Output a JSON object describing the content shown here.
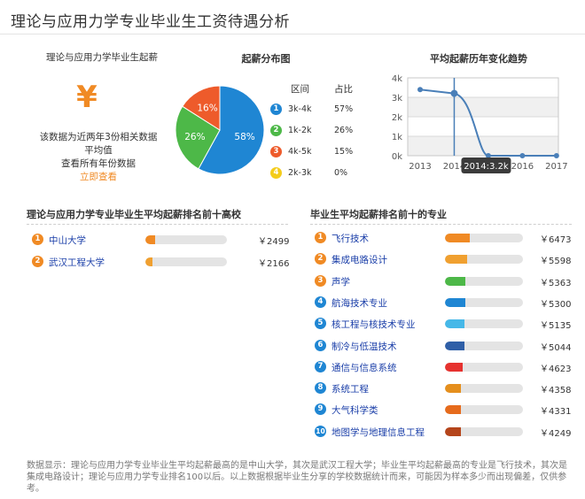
{
  "page": {
    "title": "理论与应用力学专业毕业生工资待遇分析"
  },
  "salary": {
    "title": "理论与应用力学毕业生起薪",
    "icon": "yen-icon",
    "desc_lines": [
      "该数据为近两年3份相关数据",
      "平均值",
      "查看所有年份数据"
    ],
    "link": "立即查看"
  },
  "distribution": {
    "title": "起薪分布图",
    "col_range": "区间",
    "col_pct": "占比",
    "rows": [
      {
        "num": "1",
        "range": "3k-4k",
        "pct": "57%",
        "color": "#1f86d3"
      },
      {
        "num": "2",
        "range": "1k-2k",
        "pct": "26%",
        "color": "#4db848"
      },
      {
        "num": "3",
        "range": "4k-5k",
        "pct": "15%",
        "color": "#ee5b2b"
      },
      {
        "num": "4",
        "range": "2k-3k",
        "pct": "0%",
        "color": "#f4cc1b"
      }
    ],
    "slice_labels": [
      "58%",
      "26%",
      "16%"
    ]
  },
  "chart_data": [
    {
      "type": "pie",
      "labels": [
        "3k-4k",
        "1k-2k",
        "4k-5k",
        "2k-3k"
      ],
      "values": [
        58,
        26,
        16,
        0
      ],
      "colors": [
        "#1f86d3",
        "#4db848",
        "#ee5b2b",
        "#f4cc1b"
      ]
    },
    {
      "type": "line",
      "title": "平均起薪历年变化趋势",
      "x": [
        2013,
        2014,
        2015,
        2016,
        2017
      ],
      "y": [
        3.4,
        3.2,
        0,
        0,
        0
      ],
      "ylim": [
        0,
        4
      ],
      "yticks": [
        "0k",
        "1k",
        "2k",
        "3k",
        "4k"
      ],
      "xticks": [
        "2013",
        "2014",
        "2015",
        "2016",
        "2017"
      ],
      "grid": true,
      "line_color": "#4a7fb8",
      "tooltip": "2014:3.2k"
    }
  ],
  "universities": {
    "title": "理论与应用力学专业毕业生平均起薪排名前十高校",
    "items": [
      {
        "num": "1",
        "name": "中山大学",
        "value": "￥2499",
        "fraction": 0.12,
        "num_color": "#f08a24",
        "bar_color": "#f08a24"
      },
      {
        "num": "2",
        "name": "武汉工程大学",
        "value": "￥2166",
        "fraction": 0.09,
        "num_color": "#f08a24",
        "bar_color": "#f0a030"
      }
    ]
  },
  "majors": {
    "title": "毕业生平均起薪排名前十的专业",
    "items": [
      {
        "num": "1",
        "name": "飞行技术",
        "value": "￥6473",
        "fraction": 0.32,
        "num_color": "#f08a24",
        "bar_color": "#f08a24"
      },
      {
        "num": "2",
        "name": "集成电路设计",
        "value": "￥5598",
        "fraction": 0.28,
        "num_color": "#f08a24",
        "bar_color": "#f0a030"
      },
      {
        "num": "3",
        "name": "声学",
        "value": "￥5363",
        "fraction": 0.26,
        "num_color": "#f08a24",
        "bar_color": "#4db848"
      },
      {
        "num": "4",
        "name": "航海技术专业",
        "value": "￥5300",
        "fraction": 0.26,
        "num_color": "#1f86d3",
        "bar_color": "#1f86d3"
      },
      {
        "num": "5",
        "name": "核工程与核技术专业",
        "value": "￥5135",
        "fraction": 0.25,
        "num_color": "#1f86d3",
        "bar_color": "#46b8e8"
      },
      {
        "num": "6",
        "name": "制冷与低温技术",
        "value": "￥5044",
        "fraction": 0.25,
        "num_color": "#1f86d3",
        "bar_color": "#2f5fa7"
      },
      {
        "num": "7",
        "name": "通信与信息系统",
        "value": "￥4623",
        "fraction": 0.23,
        "num_color": "#1f86d3",
        "bar_color": "#e6322f"
      },
      {
        "num": "8",
        "name": "系统工程",
        "value": "￥4358",
        "fraction": 0.21,
        "num_color": "#1f86d3",
        "bar_color": "#e58f1d"
      },
      {
        "num": "9",
        "name": "大气科学类",
        "value": "￥4331",
        "fraction": 0.21,
        "num_color": "#1f86d3",
        "bar_color": "#e66b1c"
      },
      {
        "num": "10",
        "name": "地图学与地理信息工程",
        "value": "￥4249",
        "fraction": 0.21,
        "num_color": "#1f86d3",
        "bar_color": "#b5451b"
      }
    ]
  },
  "footer": {
    "note": "数据显示：理论与应用力学专业毕业生平均起薪最高的是中山大学，其次是武汉工程大学；毕业生平均起薪最高的专业是飞行技术，其次是集成电路设计；理论与应用力学专业排名100以后。以上数据根据毕业生分享的学校数据统计而来，可能因为样本多少而出现偏差，仅供参考。"
  }
}
